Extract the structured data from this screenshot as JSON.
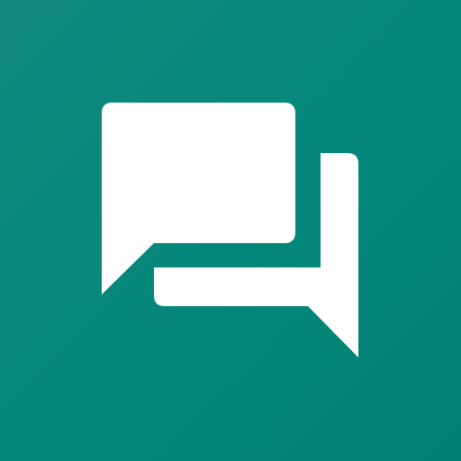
{
  "app_icon": {
    "icon": "chat-bubbles-icon",
    "background_color": "#04877a",
    "foreground_color": "#ffffff"
  }
}
